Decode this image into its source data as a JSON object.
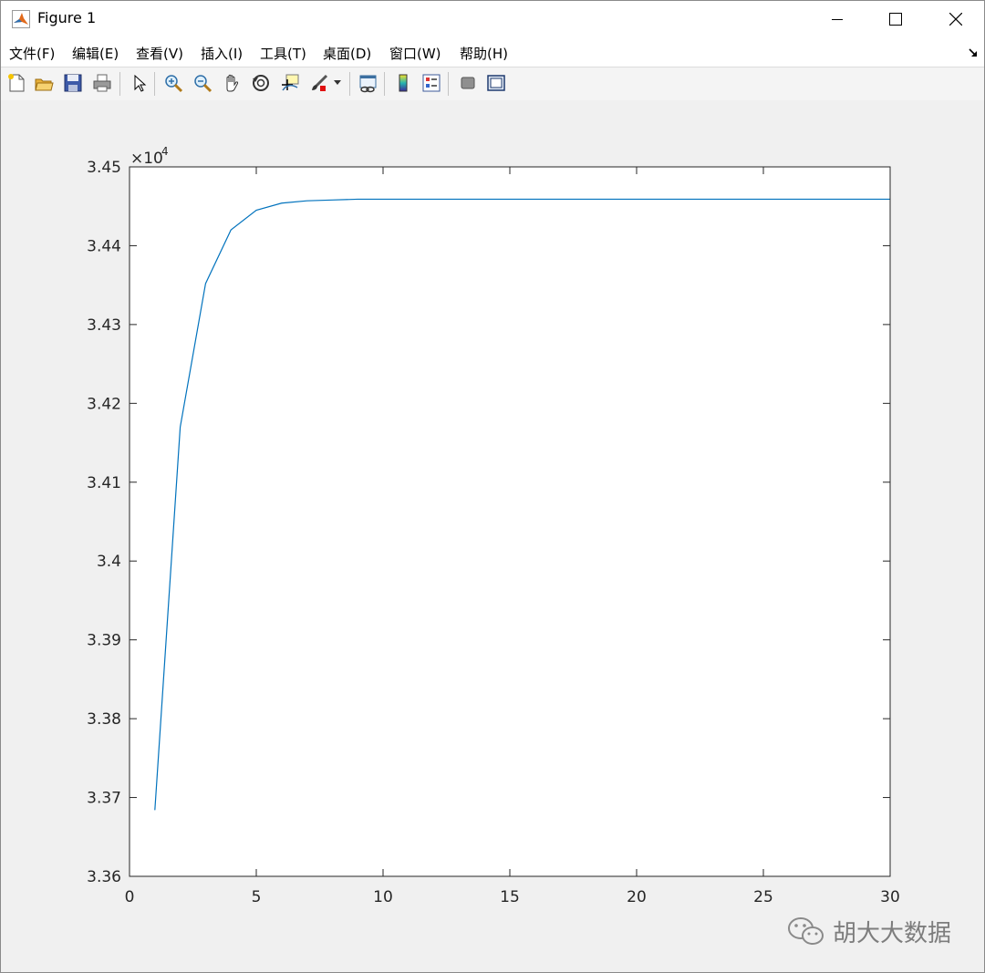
{
  "window": {
    "title": "Figure 1"
  },
  "menu": {
    "items": [
      "文件(F)",
      "编辑(E)",
      "查看(V)",
      "插入(I)",
      "工具(T)",
      "桌面(D)",
      "窗口(W)",
      "帮助(H)"
    ]
  },
  "toolbar": {
    "icons": [
      "new-figure-icon",
      "open-file-icon",
      "save-icon",
      "print-icon",
      "pointer-icon",
      "zoom-in-icon",
      "zoom-out-icon",
      "pan-hand-icon",
      "rotate-3d-icon",
      "data-cursor-icon",
      "brush-icon",
      "link-plot-icon",
      "colorbar-icon",
      "legend-icon",
      "hide-plot-tools-icon",
      "show-plot-tools-icon"
    ]
  },
  "watermark": {
    "text": "胡大大数据"
  },
  "colors": {
    "line": "#0072bd",
    "axes": "#262626",
    "plot_background": "#ffffff",
    "figure_background": "#f0f0f0"
  },
  "chart_data": {
    "type": "line",
    "title": "",
    "xlabel": "",
    "ylabel": "",
    "xlim": [
      0,
      30
    ],
    "ylim": [
      33600,
      34500
    ],
    "y_exponent_label": "×10",
    "y_exponent_power": "4",
    "xticks": [
      0,
      5,
      10,
      15,
      20,
      25,
      30
    ],
    "xtick_labels": [
      "0",
      "5",
      "10",
      "15",
      "20",
      "25",
      "30"
    ],
    "yticks": [
      33600,
      33700,
      33800,
      33900,
      34000,
      34100,
      34200,
      34300,
      34400,
      34500
    ],
    "ytick_labels": [
      "3.36",
      "3.37",
      "3.38",
      "3.39",
      "3.4",
      "3.41",
      "3.42",
      "3.43",
      "3.44",
      "3.45"
    ],
    "grid": false,
    "series": [
      {
        "x": [
          1,
          2,
          3,
          4,
          5,
          6,
          7,
          8,
          9,
          10,
          11,
          12,
          13,
          14,
          15,
          16,
          17,
          18,
          19,
          20,
          21,
          22,
          23,
          24,
          25,
          26,
          27,
          28,
          29,
          30
        ],
        "y": [
          33684,
          34170,
          34352,
          34420,
          34445,
          34454,
          34457,
          34458,
          34459,
          34459,
          34459,
          34459,
          34459,
          34459,
          34459,
          34459,
          34459,
          34459,
          34459,
          34459,
          34459,
          34459,
          34459,
          34459,
          34459,
          34459,
          34459,
          34459,
          34459,
          34459
        ]
      }
    ]
  }
}
